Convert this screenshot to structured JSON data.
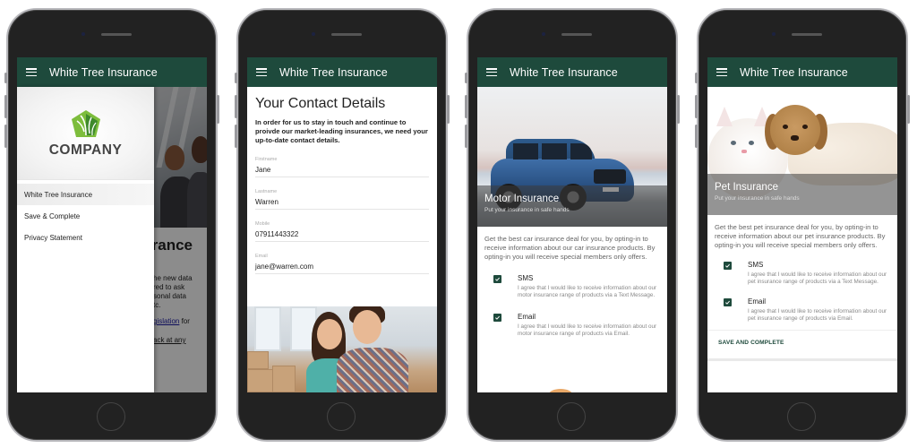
{
  "app": {
    "title": "White Tree Insurance",
    "brand_color": "#1e4a3c"
  },
  "phone1": {
    "drawer": {
      "logo_text": "COMPANY",
      "items": [
        {
          "label": "White Tree Insurance",
          "active": true
        },
        {
          "label": "Save & Complete",
          "active": false
        },
        {
          "label": "Privacy Statement",
          "active": false
        }
      ]
    },
    "background_page": {
      "heading_fragment": "rance",
      "para_lines": [
        "he new data",
        "red to ask",
        "sonal data",
        "tc."
      ],
      "link_text": "gislation",
      "link_suffix": " for",
      "link2_text": "ack at any"
    }
  },
  "phone2": {
    "heading": "Your Contact Details",
    "intro": "In order for us to stay in touch and continue to proivde our market-leading insurances, we need your up-to-date contact details.",
    "fields": [
      {
        "label": "Firstname",
        "value": "Jane"
      },
      {
        "label": "Lastname",
        "value": "Warren"
      },
      {
        "label": "Mobile",
        "value": "07911443322"
      },
      {
        "label": "Email",
        "value": "jane@warren.com"
      }
    ]
  },
  "phone3": {
    "hero_title": "Motor Insurance",
    "hero_subtitle": "Put your insurance in safe hands",
    "description": "Get the best car insurance deal for you, by opting-in to receive information about our car insurance products. By opting-in you will receive special members only offers.",
    "options": [
      {
        "name": "SMS",
        "checked": true,
        "text": "I agree that I would like to receive information about our motor insurance range of products via a Text Message."
      },
      {
        "name": "Email",
        "checked": true,
        "text": "I agree that I would like to receive information about our motor insurance range of products via Email."
      }
    ]
  },
  "phone4": {
    "hero_title": "Pet Insurance",
    "hero_subtitle": "Put your insurance in safe hands",
    "description": "Get the best pet insurance deal for you, by opting-in to receive information about our pet insurance products. By opting-in you will receive special members only offers.",
    "options": [
      {
        "name": "SMS",
        "checked": true,
        "text": "I agree that I would like to receive information about our pet insurance range of products via a Text Message."
      },
      {
        "name": "Email",
        "checked": true,
        "text": "I agree that I would like to receive information about our pet insurance range of products via Email."
      }
    ],
    "save_label": "SAVE AND COMPLETE"
  }
}
